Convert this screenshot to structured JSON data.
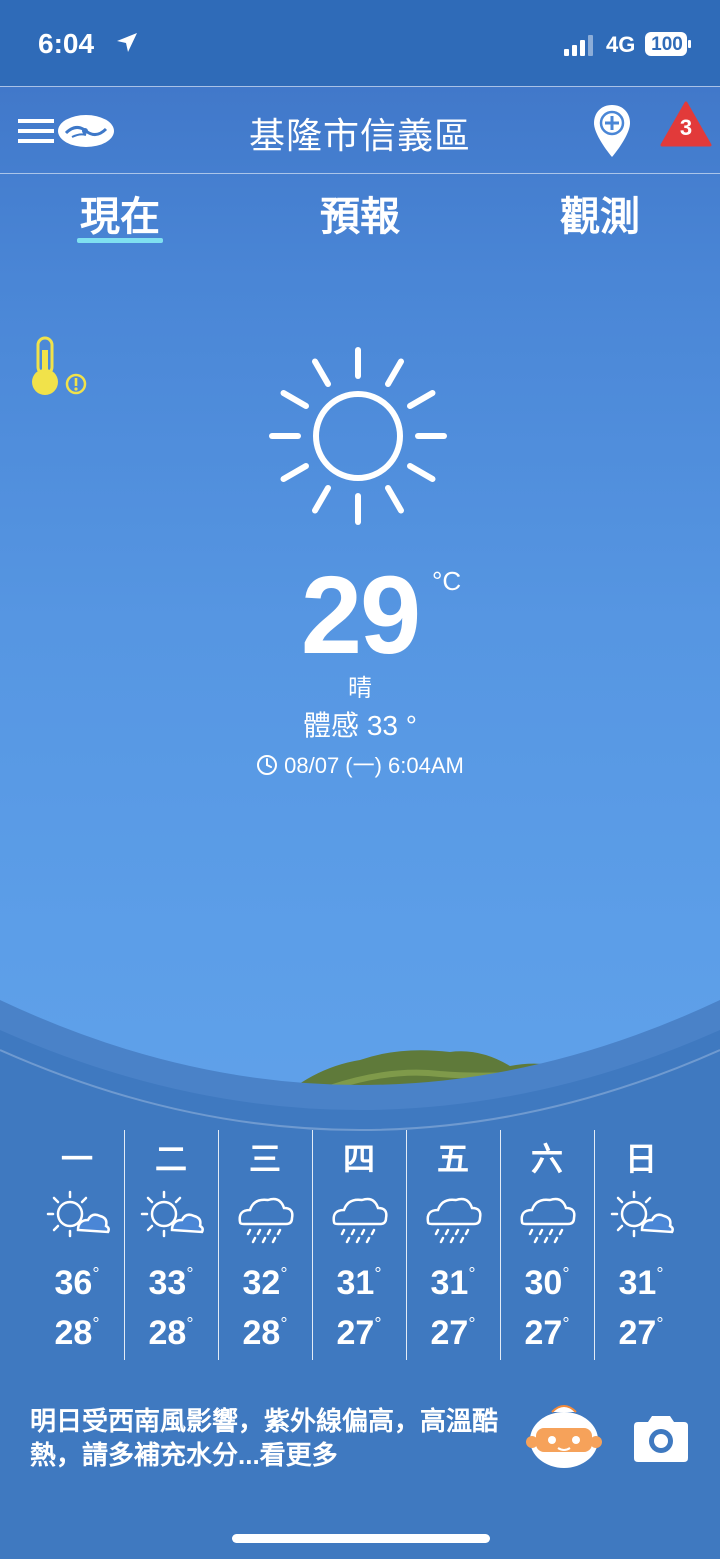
{
  "status_bar": {
    "time": "6:04",
    "network": "4G",
    "battery": "100"
  },
  "header": {
    "location": "基隆市信義區",
    "alert_count": "3"
  },
  "tabs": [
    {
      "label": "現在"
    },
    {
      "label": "預報"
    },
    {
      "label": "觀測"
    }
  ],
  "current": {
    "temperature": "29",
    "unit": "°C",
    "condition": "晴",
    "feels_like": "體感 33 °",
    "updated": "08/07 (一) 6:04AM"
  },
  "forecast": [
    {
      "day": "一",
      "high": "36",
      "low": "28",
      "icon": "sun-cloud-icon"
    },
    {
      "day": "二",
      "high": "33",
      "low": "28",
      "icon": "sun-cloud-icon"
    },
    {
      "day": "三",
      "high": "32",
      "low": "28",
      "icon": "rain-icon"
    },
    {
      "day": "四",
      "high": "31",
      "low": "27",
      "icon": "rain-icon"
    },
    {
      "day": "五",
      "high": "31",
      "low": "27",
      "icon": "rain-icon"
    },
    {
      "day": "六",
      "high": "30",
      "low": "27",
      "icon": "rain-icon"
    },
    {
      "day": "日",
      "high": "31",
      "low": "27",
      "icon": "sun-cloud-icon"
    }
  ],
  "degree_symbol": "°",
  "notice": "明日受西南風影響，紫外線偏高，高溫酷熱，請多補充水分...看更多",
  "colors": {
    "alert_red": "#e23a3a",
    "thermo_yellow": "#f1e24a",
    "tab_underline": "#7fe0f0"
  }
}
